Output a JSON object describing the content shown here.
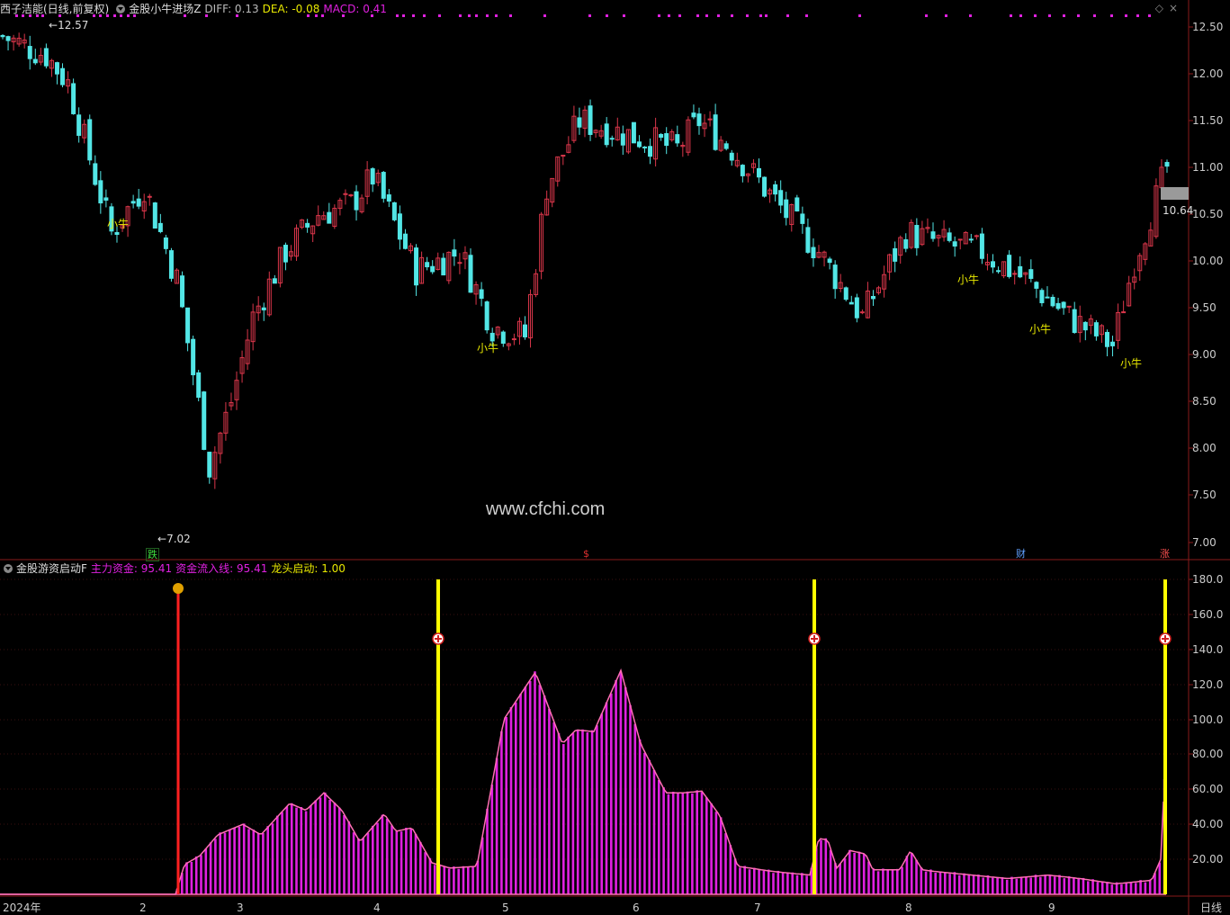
{
  "header": {
    "stock_title": "西子洁能(日线,前复权)",
    "indicator_name": "金股小牛进场Z",
    "diff_text": "DIFF: 0.13",
    "dea_text": "DEA: -0.08",
    "macd_text": "MACD: 0.41"
  },
  "subheader": {
    "indicator_name": "金股游资启动F",
    "main_fund_text": "主力资金: 95.41",
    "inflow_text": "资金流入线: 95.41",
    "leader_text": "龙头启动: 1.00"
  },
  "price_axis": [
    "12.50",
    "12.00",
    "11.50",
    "11.00",
    "10.50",
    "10.00",
    "9.50",
    "9.00",
    "8.50",
    "8.00",
    "7.50",
    "7.00"
  ],
  "sub_axis": [
    "180.0",
    "160.0",
    "140.0",
    "120.0",
    "100.0",
    "80.00",
    "60.00",
    "40.00",
    "20.00"
  ],
  "x_axis": [
    "2024年",
    "2",
    "3",
    "4",
    "5",
    "6",
    "7",
    "8",
    "9"
  ],
  "period_label": "日线",
  "annotations": {
    "high": "12.57",
    "low": "7.02",
    "last_price": "10.64",
    "signal_label": "小牛",
    "badge_down": "跌",
    "badge_money": "$",
    "badge_cai": "财",
    "badge_up": "涨"
  },
  "watermark": "www.cfchi.com",
  "colors": {
    "up": "#d9364a",
    "down": "#52e6e6",
    "fund": "#e020e0",
    "fund_line": "#ff6eb4",
    "signal_yellow": "#ffff00",
    "signal_red": "#ff2020",
    "background": "#000000"
  }
}
